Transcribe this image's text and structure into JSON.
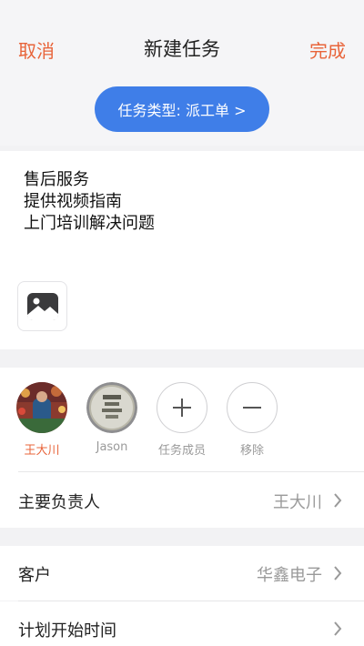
{
  "nav": {
    "cancel": "取消",
    "title": "新建任务",
    "done": "完成"
  },
  "task_type": {
    "label": "任务类型: 派工单 >"
  },
  "content": {
    "lines": [
      "售后服务",
      "提供视频指南",
      "上门培训解决问题"
    ]
  },
  "members": {
    "items": [
      {
        "name": "王大川",
        "active": true
      },
      {
        "name": "Jason",
        "active": false
      }
    ],
    "add_label": "任务成员",
    "remove_label": "移除"
  },
  "owner": {
    "label": "主要负责人",
    "value": "王大川"
  },
  "customer": {
    "label": "客户",
    "value": "华鑫电子"
  },
  "plan_start": {
    "label": "计划开始时间",
    "value": ""
  },
  "colors": {
    "accent": "#e8643a",
    "pill": "#3f7ee8",
    "muted": "#9a9a9a"
  }
}
